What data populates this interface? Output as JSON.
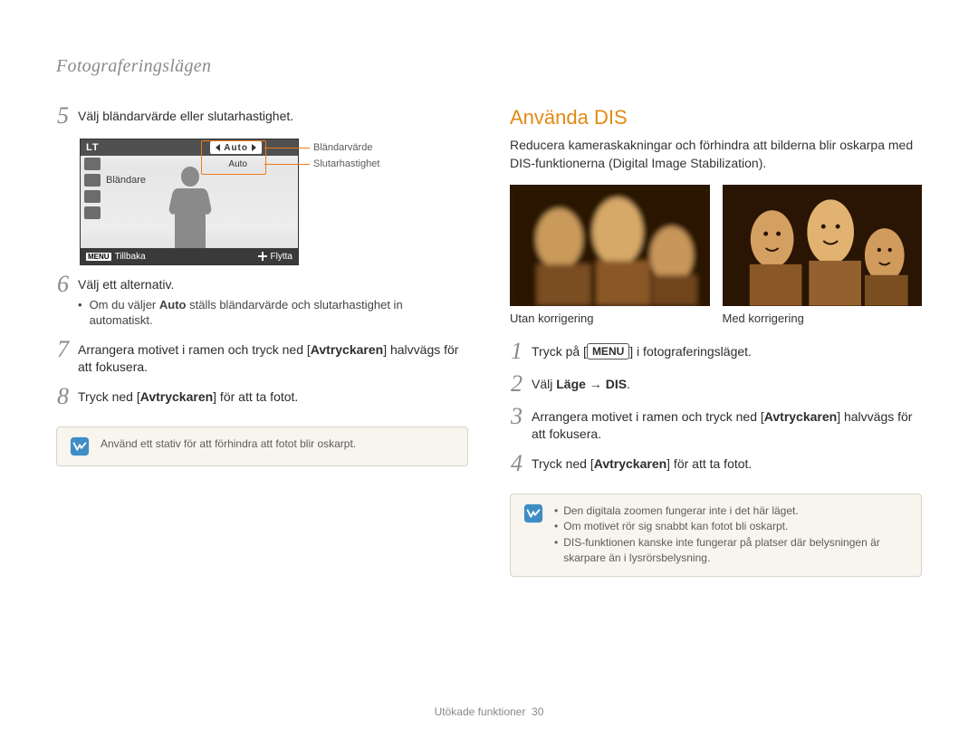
{
  "breadcrumb": "Fotograferingslägen",
  "left": {
    "steps": {
      "5": {
        "num": "5",
        "text": "Välj bländarvärde eller slutarhastighet."
      },
      "6": {
        "num": "6",
        "text": "Välj ett alternativ.",
        "bullet_pre": "Om du väljer ",
        "bullet_bold": "Auto",
        "bullet_post": " ställs bländarvärde och slutarhastighet in automatiskt."
      },
      "7": {
        "num": "7",
        "pre": "Arrangera motivet i ramen och tryck ned [",
        "bold": "Avtryckaren",
        "post": "] halvvägs för att fokusera."
      },
      "8": {
        "num": "8",
        "pre": "Tryck ned [",
        "bold": "Avtryckaren",
        "post": "] för att ta fotot."
      }
    },
    "lcd": {
      "mode": "LT",
      "pill_auto": "Auto",
      "row_auto": "Auto",
      "blandare": "Bländare",
      "footer_menu": "MENU",
      "footer_back": "Tillbaka",
      "footer_move": "Flytta"
    },
    "callout_aperture": "Bländarvärde",
    "callout_shutter": "Slutarhastighet",
    "note": "Använd ett stativ för att förhindra att fotot blir oskarpt."
  },
  "right": {
    "heading": "Använda DIS",
    "lead": "Reducera kameraskakningar och förhindra att bilderna blir oskarpa med DIS-funktionerna (Digital Image Stabilization).",
    "caption_before": "Utan korrigering",
    "caption_after": "Med korrigering",
    "steps": {
      "1": {
        "num": "1",
        "pre": "Tryck på [",
        "kbd": "MENU",
        "post": "] i fotograferingsläget."
      },
      "2": {
        "num": "2",
        "pre": "Välj ",
        "bold1": "Läge",
        "arrow": " → ",
        "bold2": "DIS",
        "post": "."
      },
      "3": {
        "num": "3",
        "pre": "Arrangera motivet i ramen och tryck ned [",
        "bold": "Avtryckaren",
        "post": "] halvvägs för att fokusera."
      },
      "4": {
        "num": "4",
        "pre": "Tryck ned [",
        "bold": "Avtryckaren",
        "post": "] för att ta fotot."
      }
    },
    "notes": {
      "a": "Den digitala zoomen fungerar inte i det här läget.",
      "b": "Om motivet rör sig snabbt kan fotot bli oskarpt.",
      "c": "DIS-funktionen kanske inte fungerar på platser där belysningen är skarpare än i lysrörsbelysning."
    }
  },
  "footer": {
    "section": "Utökade funktioner",
    "page": "30"
  }
}
